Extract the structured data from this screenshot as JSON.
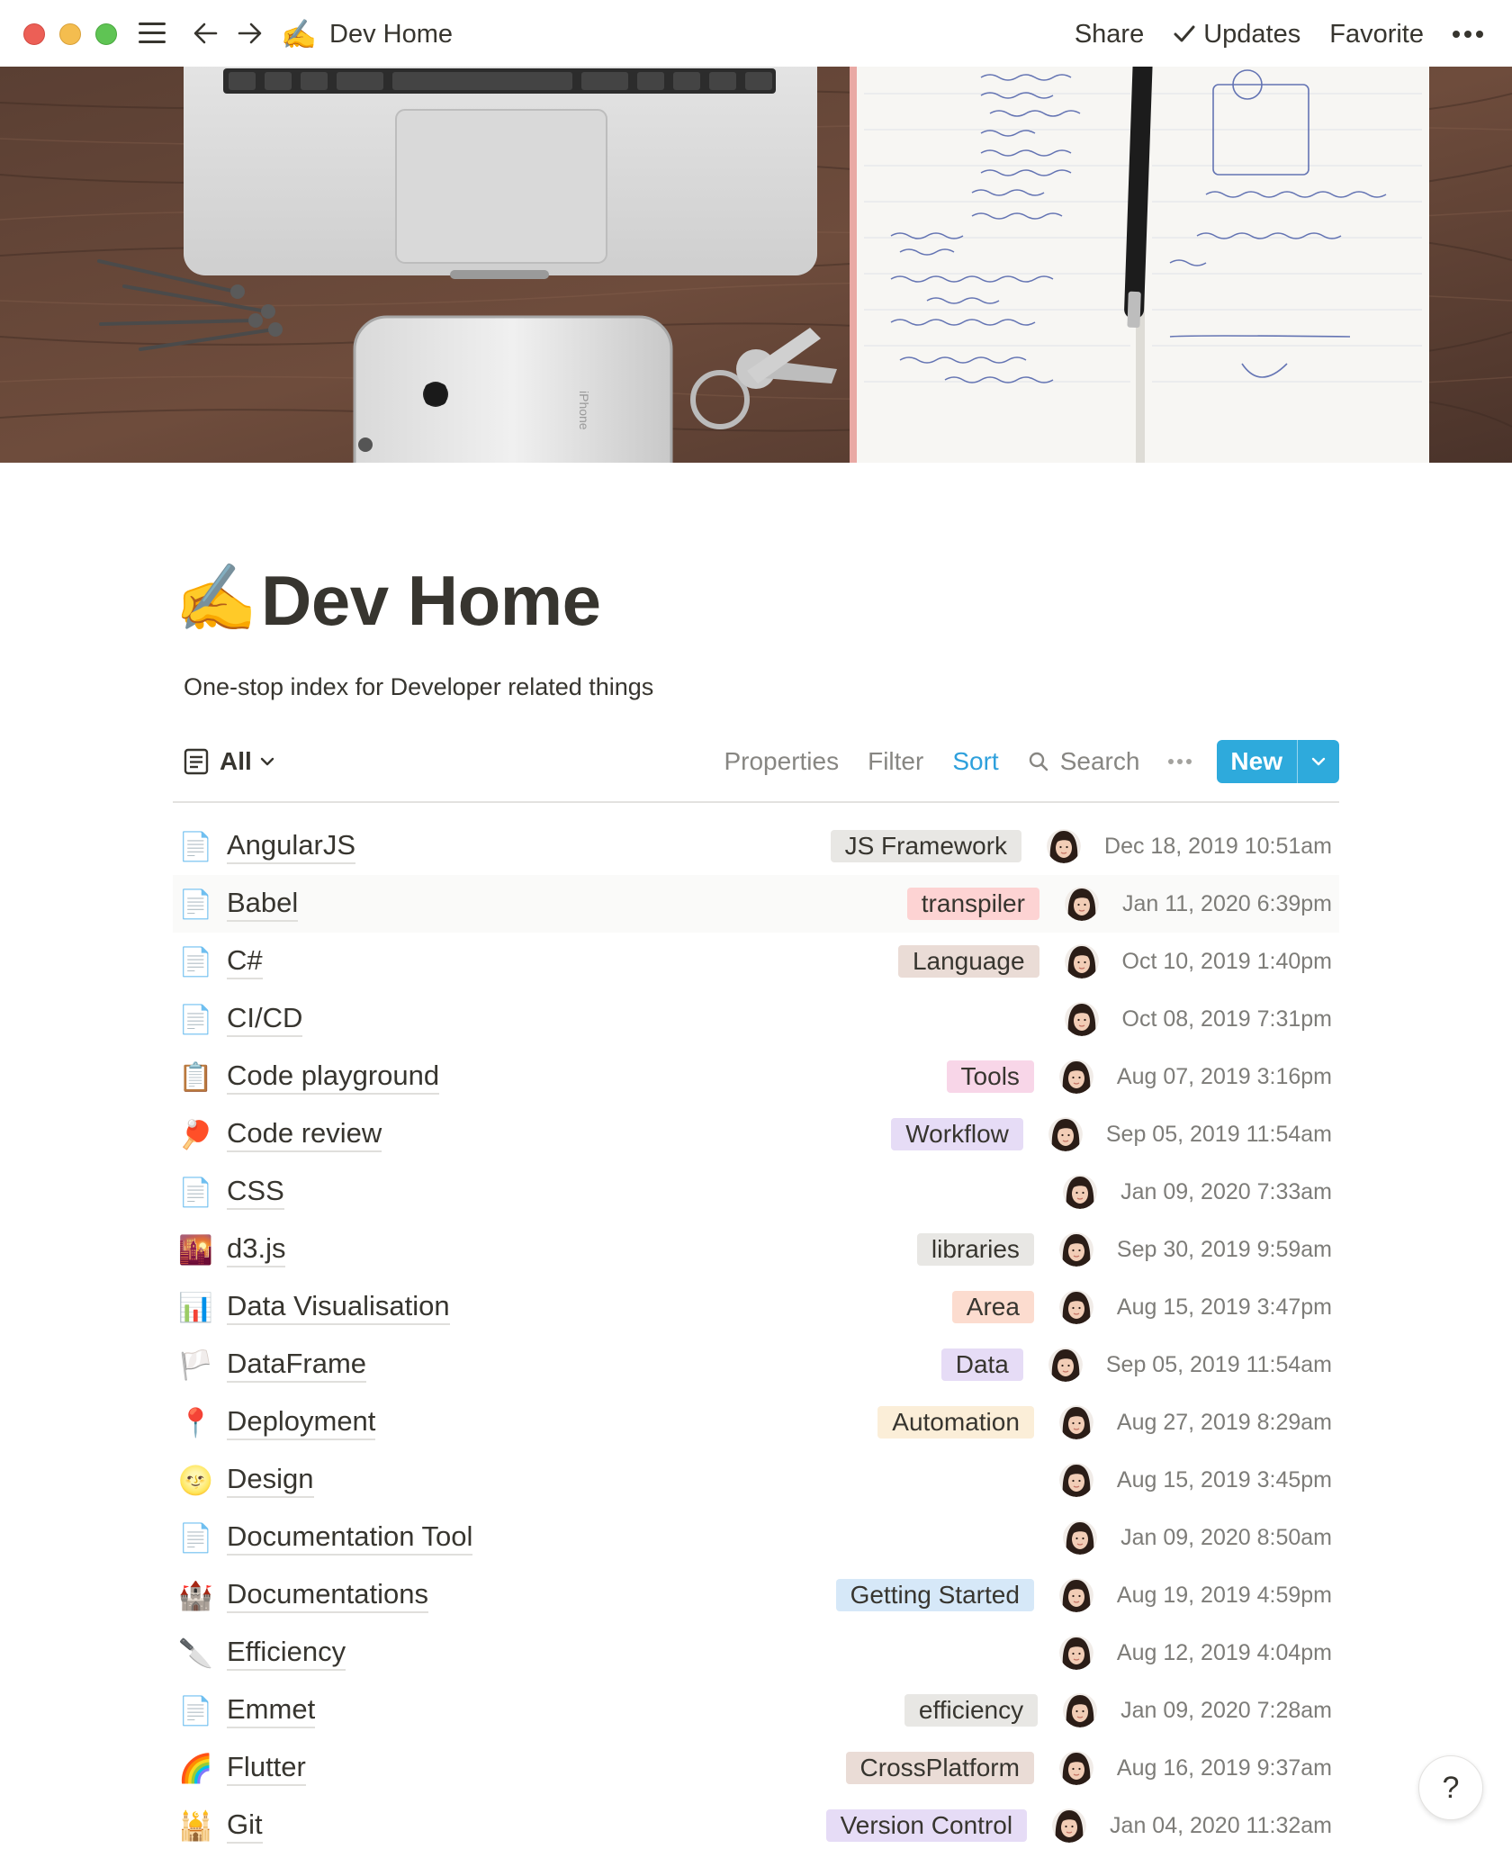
{
  "window": {
    "breadcrumb_emoji": "✍️",
    "breadcrumb_title": "Dev Home",
    "share_label": "Share",
    "updates_label": "Updates",
    "favorite_label": "Favorite"
  },
  "page": {
    "icon": "✍️",
    "title": "Dev Home",
    "description": "One-stop index for Developer related things"
  },
  "view": {
    "name": "All",
    "properties_label": "Properties",
    "filter_label": "Filter",
    "sort_label": "Sort",
    "search_label": "Search",
    "new_label": "New",
    "accent_color": "#2eaadc"
  },
  "rows": [
    {
      "icon": "📄",
      "title": "AngularJS",
      "tag": "JS Framework",
      "tag_color": "#e8e7e4",
      "date": "Dec 18, 2019 10:51am"
    },
    {
      "icon": "📄",
      "title": "Babel",
      "tag": "transpiler",
      "tag_color": "#fdd3d3",
      "date": "Jan 11, 2020 6:39pm"
    },
    {
      "icon": "📄",
      "title": "C#",
      "tag": "Language",
      "tag_color": "#eadcd6",
      "date": "Oct 10, 2019 1:40pm"
    },
    {
      "icon": "📄",
      "title": "CI/CD",
      "tag": "",
      "tag_color": "",
      "date": "Oct 08, 2019 7:31pm"
    },
    {
      "icon": "📋",
      "title": "Code playground",
      "tag": "Tools",
      "tag_color": "#f8d6e8",
      "date": "Aug 07, 2019 3:16pm"
    },
    {
      "icon": "🏓",
      "title": "Code review",
      "tag": "Workflow",
      "tag_color": "#e6dcf6",
      "date": "Sep 05, 2019 11:54am"
    },
    {
      "icon": "📄",
      "title": "CSS",
      "tag": "",
      "tag_color": "",
      "date": "Jan 09, 2020 7:33am"
    },
    {
      "icon": "🌇",
      "title": "d3.js",
      "tag": "libraries",
      "tag_color": "#e8e7e4",
      "date": "Sep 30, 2019 9:59am"
    },
    {
      "icon": "📊",
      "title": "Data Visualisation",
      "tag": "Area",
      "tag_color": "#fcdccf",
      "date": "Aug 15, 2019 3:47pm"
    },
    {
      "icon": "🏳️",
      "title": "DataFrame",
      "tag": "Data",
      "tag_color": "#e6dcf6",
      "date": "Sep 05, 2019 11:54am"
    },
    {
      "icon": "📍",
      "title": "Deployment",
      "tag": "Automation",
      "tag_color": "#fbeed8",
      "date": "Aug 27, 2019 8:29am"
    },
    {
      "icon": "🌝",
      "title": "Design",
      "tag": "",
      "tag_color": "",
      "date": "Aug 15, 2019 3:45pm"
    },
    {
      "icon": "📄",
      "title": "Documentation Tool",
      "tag": "",
      "tag_color": "",
      "date": "Jan 09, 2020 8:50am"
    },
    {
      "icon": "🏰",
      "title": "Documentations",
      "tag": "Getting Started",
      "tag_color": "#d6e8f8",
      "date": "Aug 19, 2019 4:59pm"
    },
    {
      "icon": "🔪",
      "title": "Efficiency",
      "tag": "",
      "tag_color": "",
      "date": "Aug 12, 2019 4:04pm"
    },
    {
      "icon": "📄",
      "title": "Emmet",
      "tag": "efficiency",
      "tag_color": "#e8e7e4",
      "date": "Jan 09, 2020 7:28am"
    },
    {
      "icon": "🌈",
      "title": "Flutter",
      "tag": "CrossPlatform",
      "tag_color": "#eadcd6",
      "date": "Aug 16, 2019 9:37am"
    },
    {
      "icon": "🕌",
      "title": "Git",
      "tag": "Version Control",
      "tag_color": "#e6dcf6",
      "date": "Jan 04, 2020 11:32am"
    }
  ],
  "help_label": "?"
}
